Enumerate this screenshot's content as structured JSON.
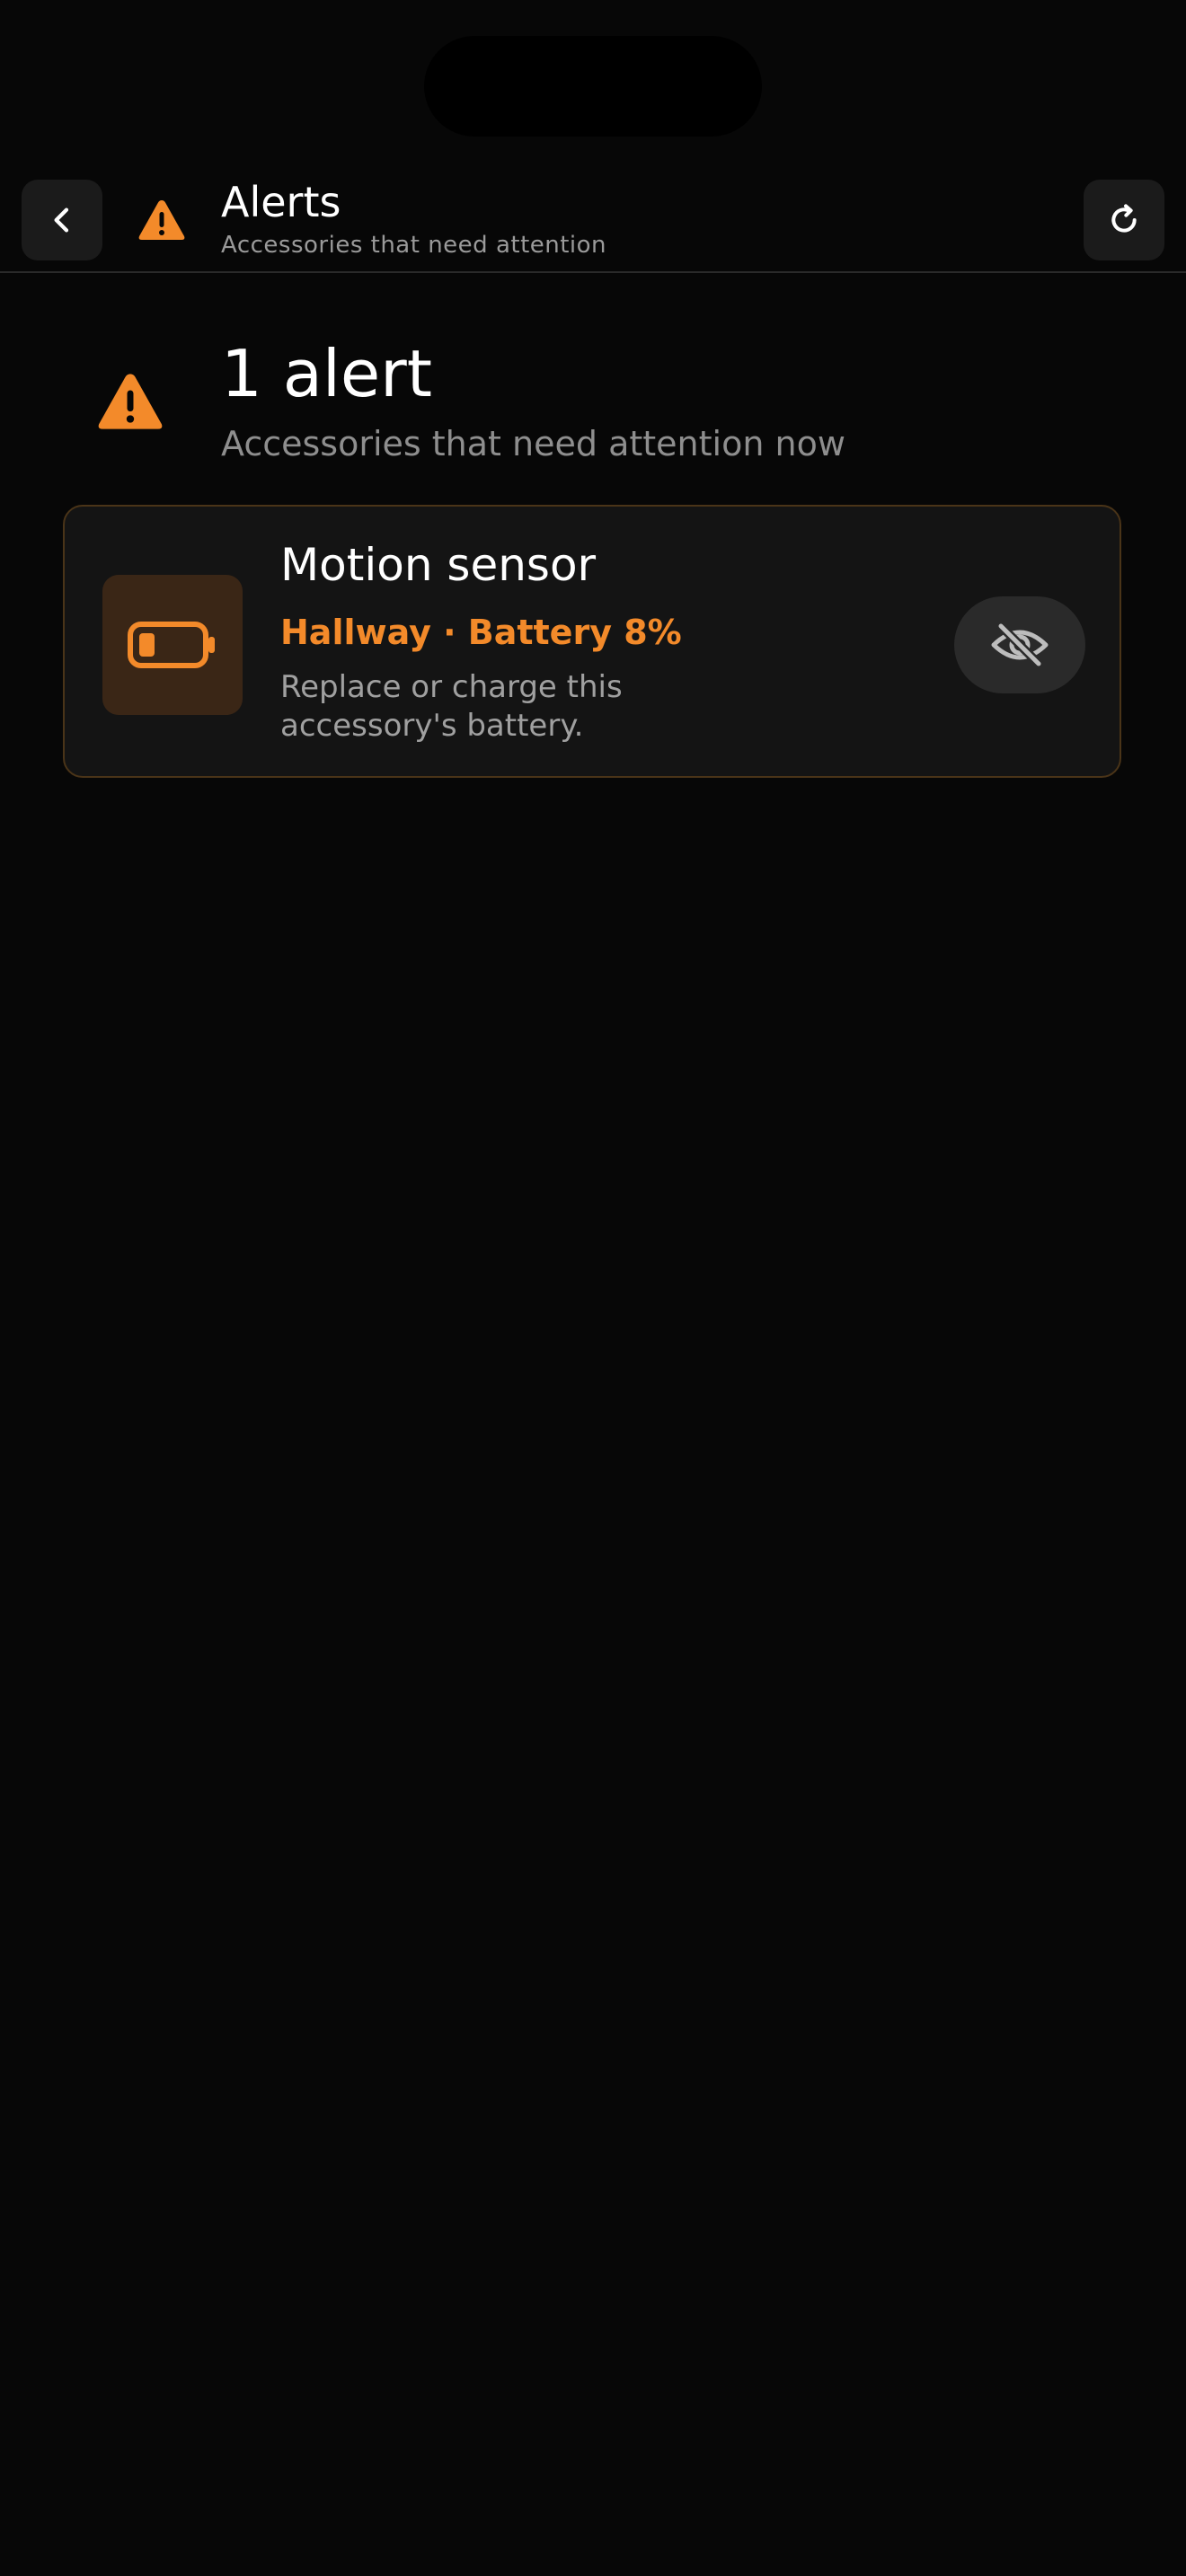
{
  "header": {
    "back_icon": "chevron-left-icon",
    "warning_icon": "warning-triangle-icon",
    "title": "Alerts",
    "subtitle": "Accessories that need attention",
    "refresh_icon": "refresh-icon"
  },
  "summary": {
    "icon": "warning-triangle-icon",
    "count_label": "1 alert",
    "description": "Accessories that need attention now"
  },
  "alerts": [
    {
      "icon": "battery-low-icon",
      "name": "Motion sensor",
      "meta": "Hallway · Battery 8%",
      "battery_level": 0.08,
      "description": "Replace or charge this accessory's battery.",
      "action_icon": "eye-slash-icon"
    }
  ],
  "colors": {
    "background": "#070707",
    "accent_orange": "#f38a2a",
    "card_background": "#141414",
    "card_border": "#4a3418",
    "muted_text": "#9a9a9a"
  }
}
